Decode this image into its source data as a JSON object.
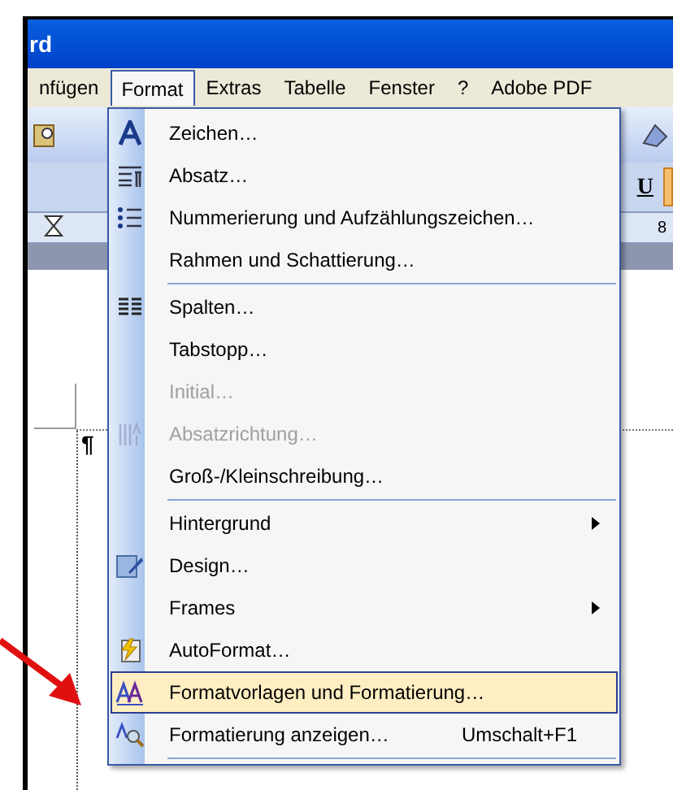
{
  "window": {
    "title": "rd"
  },
  "menu_bar": [
    {
      "label": "nfügen",
      "selected": false
    },
    {
      "label": "Format",
      "selected": true
    },
    {
      "label": "Extras",
      "selected": false
    },
    {
      "label": "Tabelle",
      "selected": false
    },
    {
      "label": "Fenster",
      "selected": false
    },
    {
      "label": "?",
      "selected": false
    },
    {
      "label": "Adobe PDF",
      "selected": false
    }
  ],
  "toolbar": {
    "underline_button": "U"
  },
  "ruler": {
    "tick_label": "8"
  },
  "document": {
    "paragraph_mark": "¶"
  },
  "format_menu": [
    {
      "label": "Zeichen…",
      "disabled": false,
      "selected": false,
      "submenu": false
    },
    {
      "label": "Absatz…",
      "disabled": false,
      "selected": false,
      "submenu": false
    },
    {
      "label": "Nummerierung und Aufzählungszeichen…",
      "disabled": false,
      "selected": false,
      "submenu": false
    },
    {
      "label": "Rahmen und Schattierung…",
      "disabled": false,
      "selected": false,
      "submenu": false,
      "separator_after": true
    },
    {
      "label": "Spalten…",
      "disabled": false,
      "selected": false,
      "submenu": false
    },
    {
      "label": "Tabstopp…",
      "disabled": false,
      "selected": false,
      "submenu": false
    },
    {
      "label": "Initial…",
      "disabled": true,
      "selected": false,
      "submenu": false
    },
    {
      "label": "Absatzrichtung…",
      "disabled": true,
      "selected": false,
      "submenu": false
    },
    {
      "label": "Groß-/Kleinschreibung…",
      "disabled": false,
      "selected": false,
      "submenu": false,
      "separator_after": true
    },
    {
      "label": "Hintergrund",
      "disabled": false,
      "selected": false,
      "submenu": true
    },
    {
      "label": "Design…",
      "disabled": false,
      "selected": false,
      "submenu": false
    },
    {
      "label": "Frames",
      "disabled": false,
      "selected": false,
      "submenu": true
    },
    {
      "label": "AutoFormat…",
      "disabled": false,
      "selected": false,
      "submenu": false
    },
    {
      "label": "Formatvorlagen und Formatierung…",
      "disabled": false,
      "selected": true,
      "submenu": false
    },
    {
      "label": "Formatierung anzeigen…",
      "disabled": false,
      "selected": false,
      "submenu": false,
      "shortcut": "Umschalt+F1",
      "separator_after": true
    }
  ]
}
